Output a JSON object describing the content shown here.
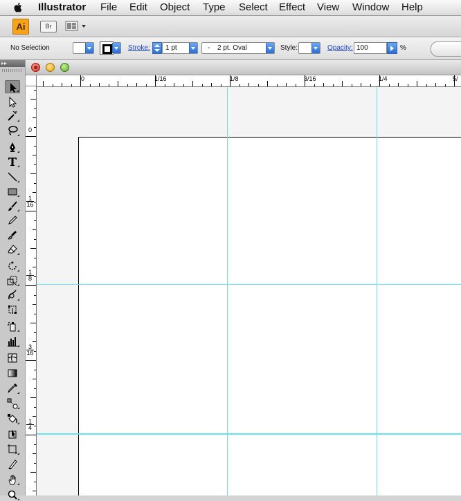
{
  "menubar": {
    "app_name": "Illustrator",
    "items": [
      "File",
      "Edit",
      "Object",
      "Type",
      "Select",
      "Effect",
      "View",
      "Window",
      "Help"
    ]
  },
  "appbar": {
    "logo": "Ai",
    "bridge": "Br"
  },
  "control": {
    "selection": "No Selection",
    "stroke_label": "Stroke:",
    "stroke_weight": "1 pt",
    "brush_dash": "-",
    "brush": "2 pt. Oval",
    "style_label": "Style:",
    "opacity_label": "Opacity:",
    "opacity_value": "100",
    "percent": "%"
  },
  "rulers": {
    "horizontal": [
      "0",
      "1/16",
      "1/8",
      "3/16",
      "1/4",
      "5/"
    ],
    "vertical": [
      {
        "top": "0",
        "bot": ""
      },
      {
        "top": "1",
        "bot": "16"
      },
      {
        "top": "1",
        "bot": "8"
      },
      {
        "top": "3",
        "bot": "16"
      },
      {
        "top": "1",
        "bot": "4"
      }
    ]
  },
  "tools": {
    "header": "▸▸",
    "items": [
      "selection-tool-icon",
      "direct-selection-tool-icon",
      "magic-wand-tool-icon",
      "lasso-tool-icon",
      "pen-tool-icon",
      "type-tool-icon",
      "line-segment-tool-icon",
      "rectangle-tool-icon",
      "paintbrush-tool-icon",
      "pencil-tool-icon",
      "blob-brush-tool-icon",
      "eraser-tool-icon",
      "rotate-tool-icon",
      "scale-tool-icon",
      "warp-tool-icon",
      "free-transform-tool-icon",
      "symbol-sprayer-tool-icon",
      "column-graph-tool-icon",
      "mesh-tool-icon",
      "gradient-tool-icon",
      "eyedropper-tool-icon",
      "blend-tool-icon",
      "live-paint-bucket-tool-icon",
      "live-paint-selection-tool-icon",
      "artboard-tool-icon",
      "slice-tool-icon",
      "hand-tool-icon",
      "zoom-tool-icon"
    ]
  },
  "colors": {
    "guide": "#65e2ef",
    "accent": "#2a6fd6",
    "ai_orange": "#f6a21b"
  }
}
